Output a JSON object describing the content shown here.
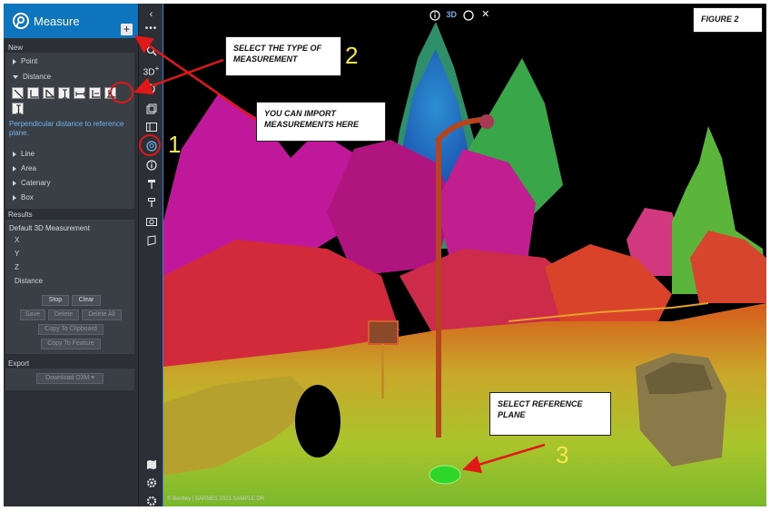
{
  "panel": {
    "title": "Measure",
    "add_label": "+",
    "new_label": "New",
    "categories": {
      "point": "Point",
      "distance": "Distance",
      "line": "Line",
      "area": "Area",
      "catenary": "Catenary",
      "box": "Box"
    },
    "distance_hint": "Perpendicular distance to reference plane.",
    "results_label": "Results",
    "result_title": "Default 3D Measurement",
    "result_fields": [
      "X",
      "Y",
      "Z",
      "Distance"
    ],
    "buttons": {
      "stop": "Stop",
      "clear": "Clear",
      "save": "Save",
      "delete": "Delete",
      "delete_all": "Delete All",
      "copy_clipboard": "Copy To Clipboard",
      "copy_feature": "Copy To Feature"
    },
    "export_label": "Export",
    "download_label": "Download O3M"
  },
  "toolbar": {
    "icons": [
      "chevron-left-icon",
      "more-icon",
      "search-icon",
      "3d-add-icon",
      "sphere-add-icon",
      "layers-icon",
      "panel-icon",
      "measure-icon",
      "info-icon",
      "pin-icon",
      "pin-outline-icon",
      "camera-icon",
      "shape-icon",
      "map-icon",
      "settings-icon",
      "gear-icon"
    ],
    "label_3d": "3D"
  },
  "viewer": {
    "mode_label": "3D",
    "copyright": "© Bentley | BARNES 2023 SAMPLE DR"
  },
  "annotations": {
    "figure": "FIGURE 2",
    "select_type": "SELECT THE TYPE OF MEASUREMENT",
    "import": "YOU CAN IMPORT MEASUREMENTS HERE",
    "reference": "SELECT REFERENCE PLANE",
    "n1": "1",
    "n2": "2",
    "n3": "3"
  },
  "colors": {
    "header_blue": "#0d74bd",
    "callout_red": "#e01818",
    "number_yellow": "#f6e84a",
    "hint_blue": "#6fb2ea"
  }
}
